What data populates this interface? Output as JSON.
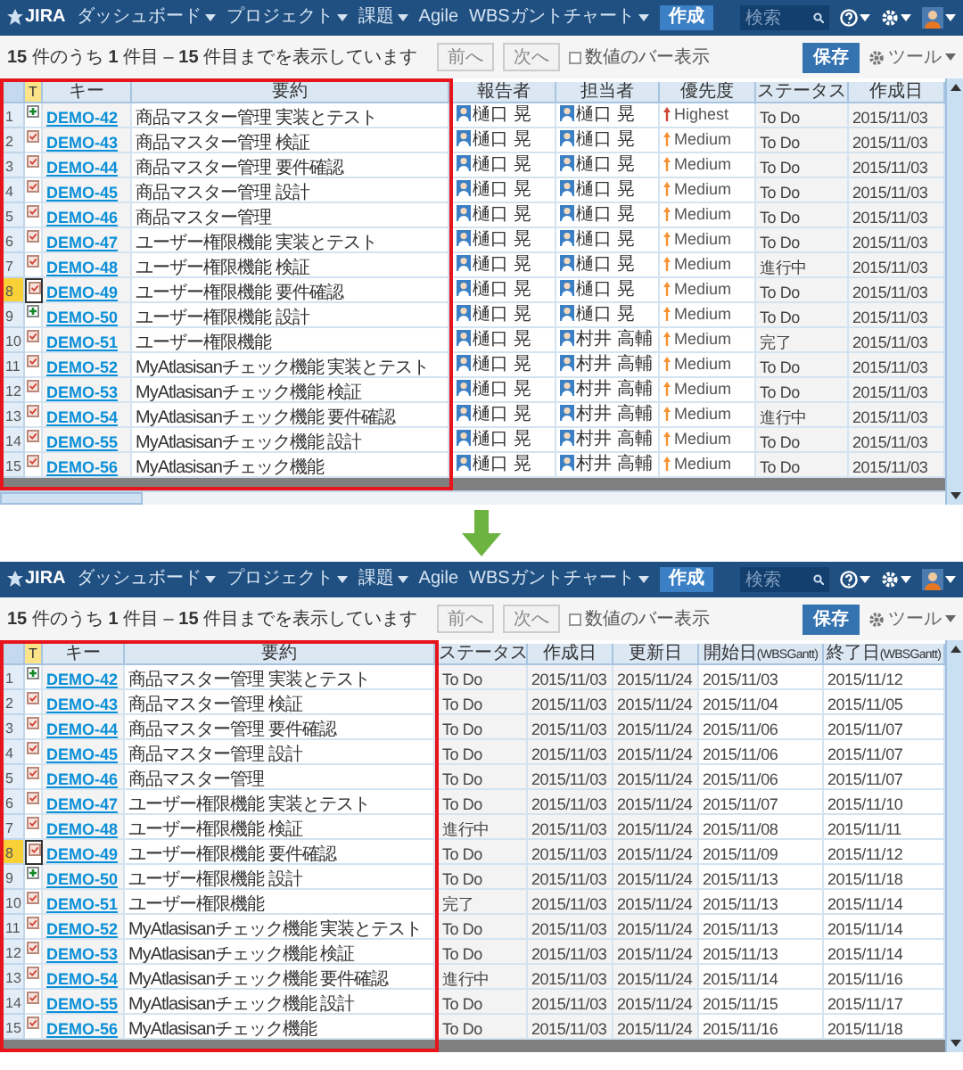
{
  "screens": [
    {
      "nav": {
        "logo": "JIRA",
        "menus": [
          {
            "label": "ダッシュボード",
            "dropdown": true
          },
          {
            "label": "プロジェクト",
            "dropdown": true
          },
          {
            "label": "課題",
            "dropdown": true
          },
          {
            "label": "Agile",
            "dropdown": false
          },
          {
            "label": "WBSガントチャート",
            "dropdown": true
          }
        ],
        "create": "作成",
        "search_placeholder": "検索"
      },
      "toolbar": {
        "summary": "**15** 件のうち **1** 件目 – **15** 件目までを表示しています",
        "prev": "前へ",
        "next": "次へ",
        "bar_toggle": {
          "label": "数値のバー表示",
          "checked": false
        },
        "save": "保存",
        "tools": "ツール"
      },
      "table": {
        "type_header": "T",
        "columns": [
          {
            "label": "キー",
            "kind": "key"
          },
          {
            "label": "要約",
            "kind": "summary"
          },
          {
            "label": "報告者",
            "kind": "person"
          },
          {
            "label": "担当者",
            "kind": "person"
          },
          {
            "label": "優先度",
            "kind": "priority"
          },
          {
            "label": "ステータス",
            "kind": "text"
          },
          {
            "label": "作成日",
            "kind": "text"
          }
        ],
        "rows": [
          {
            "number": "1",
            "selected": false,
            "kind": "plus",
            "cells": [
              "DEMO-42",
              "商品マスター管理 実装とテスト",
              "樋口 晃",
              "樋口 晃",
              {
                "text": "Highest",
                "color": "#d04437"
              },
              "To Do",
              "2015/11/03"
            ]
          },
          {
            "number": "2",
            "selected": false,
            "kind": "task",
            "cells": [
              "DEMO-43",
              "商品マスター管理 検証",
              "樋口 晃",
              "樋口 晃",
              {
                "text": "Medium",
                "color": "#f79232"
              },
              "To Do",
              "2015/11/03"
            ]
          },
          {
            "number": "3",
            "selected": false,
            "kind": "task",
            "cells": [
              "DEMO-44",
              "商品マスター管理 要件確認",
              "樋口 晃",
              "樋口 晃",
              {
                "text": "Medium",
                "color": "#f79232"
              },
              "To Do",
              "2015/11/03"
            ]
          },
          {
            "number": "4",
            "selected": false,
            "kind": "task",
            "cells": [
              "DEMO-45",
              "商品マスター管理 設計",
              "樋口 晃",
              "樋口 晃",
              {
                "text": "Medium",
                "color": "#f79232"
              },
              "To Do",
              "2015/11/03"
            ]
          },
          {
            "number": "5",
            "selected": false,
            "kind": "task",
            "cells": [
              "DEMO-46",
              "商品マスター管理",
              "樋口 晃",
              "樋口 晃",
              {
                "text": "Medium",
                "color": "#f79232"
              },
              "To Do",
              "2015/11/03"
            ]
          },
          {
            "number": "6",
            "selected": false,
            "kind": "task",
            "cells": [
              "DEMO-47",
              "ユーザー権限機能 実装とテスト",
              "樋口 晃",
              "樋口 晃",
              {
                "text": "Medium",
                "color": "#f79232"
              },
              "To Do",
              "2015/11/03"
            ]
          },
          {
            "number": "7",
            "selected": false,
            "kind": "task",
            "cells": [
              "DEMO-48",
              "ユーザー権限機能 検証",
              "樋口 晃",
              "樋口 晃",
              {
                "text": "Medium",
                "color": "#f79232"
              },
              "進行中",
              "2015/11/03"
            ]
          },
          {
            "number": "8",
            "selected": true,
            "kind": "task",
            "cells": [
              "DEMO-49",
              "ユーザー権限機能 要件確認",
              "樋口 晃",
              "樋口 晃",
              {
                "text": "Medium",
                "color": "#f79232"
              },
              "To Do",
              "2015/11/03"
            ]
          },
          {
            "number": "9",
            "selected": false,
            "kind": "plus",
            "cells": [
              "DEMO-50",
              "ユーザー権限機能 設計",
              "樋口 晃",
              "樋口 晃",
              {
                "text": "Medium",
                "color": "#f79232"
              },
              "To Do",
              "2015/11/03"
            ]
          },
          {
            "number": "10",
            "selected": false,
            "kind": "task",
            "cells": [
              "DEMO-51",
              "ユーザー権限機能",
              "樋口 晃",
              "村井 高輔",
              {
                "text": "Medium",
                "color": "#f79232"
              },
              "完了",
              "2015/11/03"
            ]
          },
          {
            "number": "11",
            "selected": false,
            "kind": "task",
            "cells": [
              "DEMO-52",
              "MyAtlasisanチェック機能 実装とテスト",
              "樋口 晃",
              "村井 高輔",
              {
                "text": "Medium",
                "color": "#f79232"
              },
              "To Do",
              "2015/11/03"
            ]
          },
          {
            "number": "12",
            "selected": false,
            "kind": "task",
            "cells": [
              "DEMO-53",
              "MyAtlasisanチェック機能 検証",
              "樋口 晃",
              "村井 高輔",
              {
                "text": "Medium",
                "color": "#f79232"
              },
              "To Do",
              "2015/11/03"
            ]
          },
          {
            "number": "13",
            "selected": false,
            "kind": "task",
            "cells": [
              "DEMO-54",
              "MyAtlasisanチェック機能 要件確認",
              "樋口 晃",
              "村井 高輔",
              {
                "text": "Medium",
                "color": "#f79232"
              },
              "進行中",
              "2015/11/03"
            ]
          },
          {
            "number": "14",
            "selected": false,
            "kind": "task",
            "cells": [
              "DEMO-55",
              "MyAtlasisanチェック機能 設計",
              "樋口 晃",
              "村井 高輔",
              {
                "text": "Medium",
                "color": "#f79232"
              },
              "To Do",
              "2015/11/03"
            ]
          },
          {
            "number": "15",
            "selected": false,
            "kind": "task",
            "cells": [
              "DEMO-56",
              "MyAtlasisanチェック機能",
              "樋口 晃",
              "村井 高輔",
              {
                "text": "Medium",
                "color": "#f79232"
              },
              "To Do",
              "2015/11/03"
            ]
          }
        ]
      }
    },
    {
      "nav": {
        "logo": "JIRA",
        "menus": [
          {
            "label": "ダッシュボード",
            "dropdown": true
          },
          {
            "label": "プロジェクト",
            "dropdown": true
          },
          {
            "label": "課題",
            "dropdown": true
          },
          {
            "label": "Agile",
            "dropdown": false
          },
          {
            "label": "WBSガントチャート",
            "dropdown": true
          }
        ],
        "create": "作成",
        "search_placeholder": "検索"
      },
      "toolbar": {
        "summary": "**15** 件のうち **1** 件目 – **15** 件目までを表示しています",
        "prev": "前へ",
        "next": "次へ",
        "bar_toggle": {
          "label": "数値のバー表示",
          "checked": false
        },
        "save": "保存",
        "tools": "ツール"
      },
      "table": {
        "type_header": "T",
        "columns": [
          {
            "label": "キー",
            "kind": "key"
          },
          {
            "label": "要約",
            "kind": "summary"
          },
          {
            "label": "ステータス",
            "kind": "text"
          },
          {
            "label": "作成日",
            "kind": "text"
          },
          {
            "label": "更新日",
            "kind": "text"
          },
          {
            "label": "開始日",
            "note": "(WBSGantt)",
            "kind": "text"
          },
          {
            "label": "終了日",
            "note": "(WBSGantt)",
            "kind": "text"
          }
        ],
        "rows": [
          {
            "number": "1",
            "selected": false,
            "kind": "plus",
            "cells": [
              "DEMO-42",
              "商品マスター管理 実装とテスト",
              "To Do",
              "2015/11/03",
              "2015/11/24",
              "2015/11/03",
              "2015/11/12"
            ]
          },
          {
            "number": "2",
            "selected": false,
            "kind": "task",
            "cells": [
              "DEMO-43",
              "商品マスター管理 検証",
              "To Do",
              "2015/11/03",
              "2015/11/24",
              "2015/11/04",
              "2015/11/05"
            ]
          },
          {
            "number": "3",
            "selected": false,
            "kind": "task",
            "cells": [
              "DEMO-44",
              "商品マスター管理 要件確認",
              "To Do",
              "2015/11/03",
              "2015/11/24",
              "2015/11/06",
              "2015/11/07"
            ]
          },
          {
            "number": "4",
            "selected": false,
            "kind": "task",
            "cells": [
              "DEMO-45",
              "商品マスター管理 設計",
              "To Do",
              "2015/11/03",
              "2015/11/24",
              "2015/11/06",
              "2015/11/07"
            ]
          },
          {
            "number": "5",
            "selected": false,
            "kind": "task",
            "cells": [
              "DEMO-46",
              "商品マスター管理",
              "To Do",
              "2015/11/03",
              "2015/11/24",
              "2015/11/06",
              "2015/11/07"
            ]
          },
          {
            "number": "6",
            "selected": false,
            "kind": "task",
            "cells": [
              "DEMO-47",
              "ユーザー権限機能 実装とテスト",
              "To Do",
              "2015/11/03",
              "2015/11/24",
              "2015/11/07",
              "2015/11/10"
            ]
          },
          {
            "number": "7",
            "selected": false,
            "kind": "task",
            "cells": [
              "DEMO-48",
              "ユーザー権限機能 検証",
              "進行中",
              "2015/11/03",
              "2015/11/24",
              "2015/11/08",
              "2015/11/11"
            ]
          },
          {
            "number": "8",
            "selected": true,
            "kind": "task",
            "cells": [
              "DEMO-49",
              "ユーザー権限機能 要件確認",
              "To Do",
              "2015/11/03",
              "2015/11/24",
              "2015/11/09",
              "2015/11/12"
            ]
          },
          {
            "number": "9",
            "selected": false,
            "kind": "plus",
            "cells": [
              "DEMO-50",
              "ユーザー権限機能 設計",
              "To Do",
              "2015/11/03",
              "2015/11/24",
              "2015/11/13",
              "2015/11/18"
            ]
          },
          {
            "number": "10",
            "selected": false,
            "kind": "task",
            "cells": [
              "DEMO-51",
              "ユーザー権限機能",
              "完了",
              "2015/11/03",
              "2015/11/24",
              "2015/11/13",
              "2015/11/14"
            ]
          },
          {
            "number": "11",
            "selected": false,
            "kind": "task",
            "cells": [
              "DEMO-52",
              "MyAtlasisanチェック機能 実装とテスト",
              "To Do",
              "2015/11/03",
              "2015/11/24",
              "2015/11/13",
              "2015/11/14"
            ]
          },
          {
            "number": "12",
            "selected": false,
            "kind": "task",
            "cells": [
              "DEMO-53",
              "MyAtlasisanチェック機能 検証",
              "To Do",
              "2015/11/03",
              "2015/11/24",
              "2015/11/13",
              "2015/11/14"
            ]
          },
          {
            "number": "13",
            "selected": false,
            "kind": "task",
            "cells": [
              "DEMO-54",
              "MyAtlasisanチェック機能 要件確認",
              "進行中",
              "2015/11/03",
              "2015/11/24",
              "2015/11/14",
              "2015/11/16"
            ]
          },
          {
            "number": "14",
            "selected": false,
            "kind": "task",
            "cells": [
              "DEMO-55",
              "MyAtlasisanチェック機能 設計",
              "To Do",
              "2015/11/03",
              "2015/11/24",
              "2015/11/15",
              "2015/11/17"
            ]
          },
          {
            "number": "15",
            "selected": false,
            "kind": "task",
            "cells": [
              "DEMO-56",
              "MyAtlasisanチェック機能",
              "To Do",
              "2015/11/03",
              "2015/11/24",
              "2015/11/16",
              "2015/11/18"
            ]
          }
        ]
      }
    }
  ]
}
